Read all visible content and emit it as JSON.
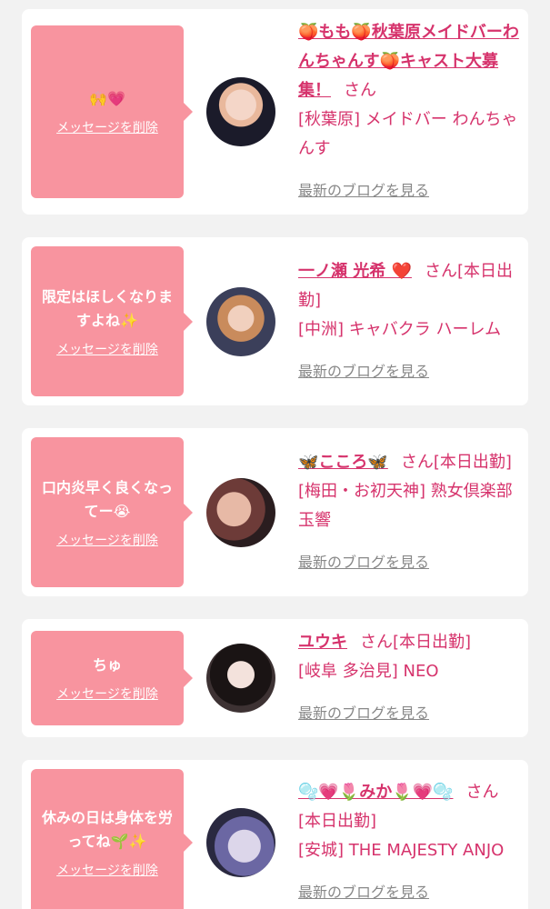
{
  "cards": [
    {
      "message": "🙌💗",
      "delete_label": "メッセージを削除",
      "name": "🍑もも🍑秋葉原メイドバーわんちゃんす🍑キャスト大募集！",
      "suffix": "さん",
      "shop": "[秋葉原] メイドバー わんちゃんす",
      "blog_label": "最新のブログを見る"
    },
    {
      "message": "限定はほしくなりますよね✨",
      "delete_label": "メッセージを削除",
      "name": "一ノ瀬 光希 ❤️",
      "suffix": "さん[本日出勤]",
      "shop": "[中洲] キャバクラ ハーレム",
      "blog_label": "最新のブログを見る"
    },
    {
      "message": "口内炎早く良くなってー😭",
      "delete_label": "メッセージを削除",
      "name": "🦋こころ🦋",
      "suffix": "さん[本日出勤]",
      "shop": "[梅田・お初天神] 熟女倶楽部 玉響",
      "blog_label": "最新のブログを見る"
    },
    {
      "message": "ちゅ",
      "delete_label": "メッセージを削除",
      "name": "ユウキ",
      "suffix": "さん[本日出勤]",
      "shop": "[岐阜 多治見] NEO",
      "blog_label": "最新のブログを見る"
    },
    {
      "message": "休みの日は身体を労ってね🌱✨",
      "delete_label": "メッセージを削除",
      "name": "🫧💗🌷みか🌷💗🫧",
      "suffix": "さん[本日出勤]",
      "shop": "[安城] THE MAJESTY ANJO",
      "blog_label": "最新のブログを見る"
    }
  ],
  "colors": {
    "accent": "#d6336c",
    "bubble": "#f8949f",
    "background": "#f2f2f2",
    "link_gray": "#888888"
  }
}
